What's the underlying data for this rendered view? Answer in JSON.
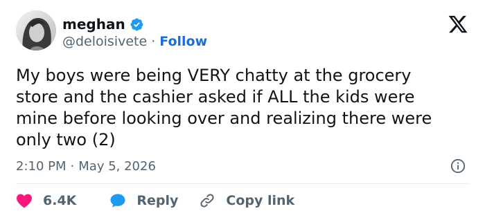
{
  "author": {
    "name": "meghan",
    "handle": "@deloisivete",
    "separator": "·",
    "follow_label": "Follow",
    "verified": true
  },
  "platform": {
    "logo": "x-logo-icon"
  },
  "tweet": {
    "text": "My boys were being VERY chatty at the grocery\nstore and the cashier asked if ALL the kids were\nmine before looking over and realizing there were\nonly two (2)"
  },
  "meta": {
    "time": "2:10 PM",
    "separator": "·",
    "date": "May 5, 2026"
  },
  "actions": {
    "likes": "6.4K",
    "reply_label": "Reply",
    "copy_link_label": "Copy link"
  },
  "colors": {
    "text": "#0f1419",
    "secondary": "#536471",
    "link": "#1d6fd6",
    "like": "#f91880",
    "reply": "#1d9bf0",
    "verified": "#1d9bf0",
    "divider": "#e1e8ed"
  },
  "icons": {
    "verified": "verified-badge-icon",
    "info": "info-icon",
    "like": "heart-icon",
    "reply": "speech-bubble-icon",
    "copy_link": "link-icon"
  }
}
